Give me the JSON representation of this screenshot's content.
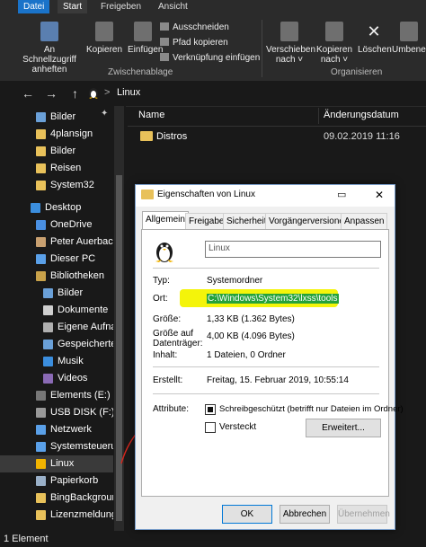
{
  "ribbon": {
    "tabs": [
      "Datei",
      "Start",
      "Freigeben",
      "Ansicht"
    ],
    "buttons": {
      "pin": "An Schnellzugriff anheften",
      "copy": "Kopieren",
      "paste": "Einfügen",
      "cut": "Ausschneiden",
      "copy_path": "Pfad kopieren",
      "paste_shortcut": "Verknüpfung einfügen",
      "move_to": "Verschieben nach ˅",
      "copy_to": "Kopieren nach ˅",
      "delete": "Löschen",
      "rename": "Umbenen"
    },
    "groups": {
      "clipboard": "Zwischenablage",
      "organize": "Organisieren"
    }
  },
  "addressbar": {
    "back": "←",
    "forward": "→",
    "up": "↑",
    "sep": ">",
    "location": "Linux"
  },
  "sidebar": {
    "items": [
      {
        "label": "Bilder",
        "icon": "pictures-icon",
        "pin": "✦"
      },
      {
        "label": "4plansign",
        "icon": "folder-icon"
      },
      {
        "label": "Bilder",
        "icon": "folder-icon"
      },
      {
        "label": "Reisen",
        "icon": "folder-icon"
      },
      {
        "label": "System32",
        "icon": "folder-icon"
      },
      {
        "label": "Desktop",
        "icon": "desktop-icon"
      },
      {
        "label": "OneDrive",
        "icon": "cloud-icon"
      },
      {
        "label": "Peter Auerbache",
        "icon": "user-icon"
      },
      {
        "label": "Dieser PC",
        "icon": "computer-icon"
      },
      {
        "label": "Bibliotheken",
        "icon": "library-icon"
      },
      {
        "label": "Bilder",
        "icon": "pictures-icon"
      },
      {
        "label": "Dokumente",
        "icon": "documents-icon"
      },
      {
        "label": "Eigene Aufnah",
        "icon": "recordings-icon"
      },
      {
        "label": "Gespeicherte B",
        "icon": "saved-pictures-icon"
      },
      {
        "label": "Musik",
        "icon": "music-icon"
      },
      {
        "label": "Videos",
        "icon": "videos-icon"
      },
      {
        "label": "Elements (E:)",
        "icon": "drive-icon"
      },
      {
        "label": "USB DISK (F:)",
        "icon": "usb-drive-icon"
      },
      {
        "label": "Netzwerk",
        "icon": "network-icon"
      },
      {
        "label": "Systemsteuerung",
        "icon": "control-panel-icon"
      },
      {
        "label": "Linux",
        "icon": "linux-icon"
      },
      {
        "label": "Papierkorb",
        "icon": "recycle-bin-icon"
      },
      {
        "label": "BingBackgrounc",
        "icon": "folder-icon"
      },
      {
        "label": "Lizenzmeldunge",
        "icon": "folder-icon"
      }
    ]
  },
  "content": {
    "col_name": "Name",
    "col_date": "Änderungsdatum",
    "rows": [
      {
        "name": "Distros",
        "date": "09.02.2019 11:16"
      }
    ]
  },
  "statusbar": {
    "text": "1 Element"
  },
  "dialog": {
    "title": "Eigenschaften von Linux",
    "controls": {
      "minimize": "▭",
      "close": "✕"
    },
    "tabs": [
      "Allgemein",
      "Freigabe",
      "Sicherheit",
      "Vorgängerversionen",
      "Anpassen"
    ],
    "name_value": "Linux",
    "props": {
      "type_label": "Typ:",
      "type_value": "Systemordner",
      "location_label": "Ort:",
      "location_value": "C:\\Windows\\System32\\lxss\\tools",
      "size_label": "Größe:",
      "size_value": "1,33 KB (1.362 Bytes)",
      "disk_label": "Größe auf Datenträger:",
      "disk_value": "4,00 KB (4.096 Bytes)",
      "contents_label": "Inhalt:",
      "contents_value": "1 Dateien, 0 Ordner",
      "created_label": "Erstellt:",
      "created_value": "Freitag, 15. Februar 2019, 10:55:14",
      "attr_label": "Attribute:",
      "readonly_label": "Schreibgeschützt (betrifft nur Dateien im Ordner)",
      "hidden_label": "Versteckt",
      "advanced_btn": "Erweitert..."
    },
    "buttons": {
      "ok": "OK",
      "cancel": "Abbrechen",
      "apply": "Übernehmen"
    }
  },
  "colors": {
    "accent": "#1a73c9",
    "highlight": "#ffff00",
    "annotation": "#d9261c"
  }
}
